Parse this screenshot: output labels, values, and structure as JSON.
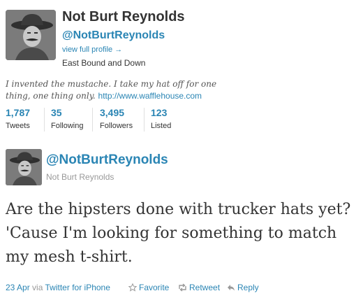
{
  "profile": {
    "name": "Not Burt Reynolds",
    "handle": "@NotBurtReynolds",
    "view_full_profile": "view full profile →",
    "location": "East Bound and Down",
    "bio": "I invented the mustache. I take my hat off for one thing, one thing only.",
    "bio_link": "http://www.wafflehouse.com",
    "stats": [
      {
        "count": "1,787",
        "label": "Tweets"
      },
      {
        "count": "35",
        "label": "Following"
      },
      {
        "count": "3,495",
        "label": "Followers"
      },
      {
        "count": "123",
        "label": "Listed"
      }
    ]
  },
  "tweet": {
    "handle": "@NotBurtReynolds",
    "name": "Not Burt Reynolds",
    "text": "Are the hipsters done with trucker hats yet? 'Cause I'm looking for something to match my mesh t-shirt.",
    "date": "23 Apr",
    "via": "via",
    "source": "Twitter for iPhone",
    "actions": {
      "favorite": "Favorite",
      "retweet": "Retweet",
      "reply": "Reply"
    }
  },
  "colors": {
    "link": "#2a85b4",
    "text": "#333333",
    "muted": "#999999"
  }
}
